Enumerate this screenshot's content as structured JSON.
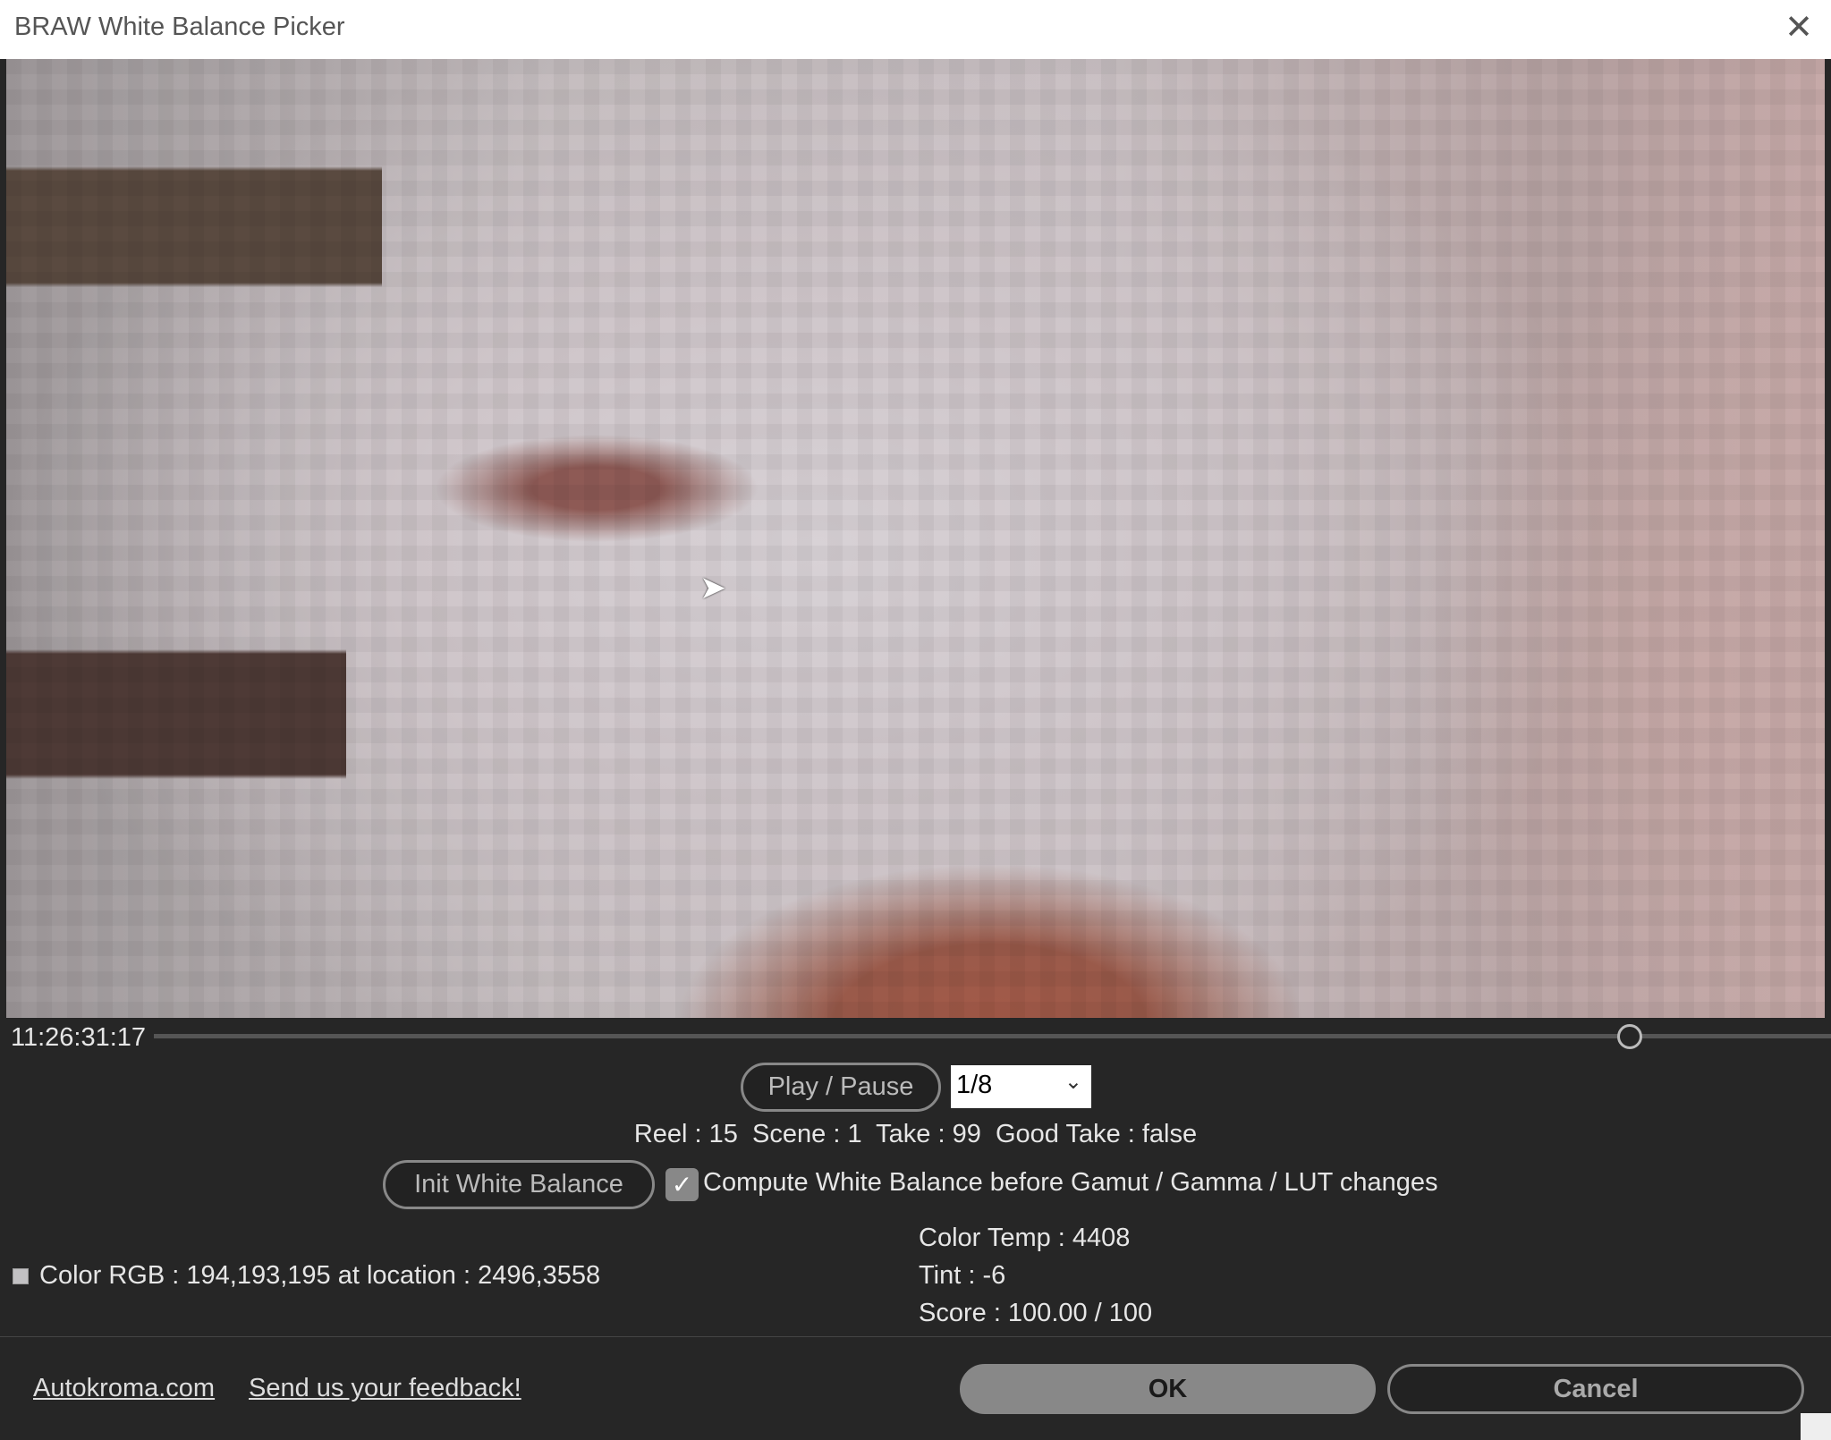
{
  "window": {
    "title": "BRAW White Balance Picker",
    "close_icon": "close-icon"
  },
  "playback": {
    "timecode": "11:26:31:17",
    "position_fraction": 0.88,
    "play_pause_label": "Play / Pause",
    "speed_value": "1/8"
  },
  "metadata": {
    "text": "Reel : 15  Scene : 1  Take : 99  Good Take : false"
  },
  "white_balance": {
    "init_label": "Init White Balance",
    "compute_checkbox_label": "Compute White Balance before Gamut / Gamma / LUT changes",
    "compute_checked": true
  },
  "sample": {
    "text": "Color RGB : 194,193,195 at location : 2496,3558",
    "swatch_color": "#c2c1c3"
  },
  "stats": {
    "color_temp": "Color Temp : 4408",
    "tint": "Tint : -6",
    "score": "Score : 100.00 / 100"
  },
  "footer": {
    "website_link": "Autokroma.com",
    "feedback_link": "Send us your feedback!",
    "ok_label": "OK",
    "cancel_label": "Cancel"
  }
}
